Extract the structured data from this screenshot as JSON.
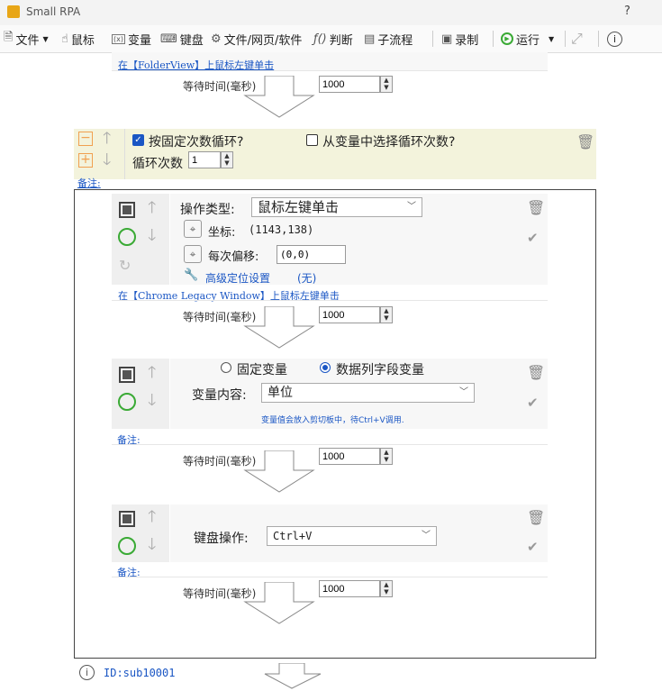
{
  "window": {
    "title": "Small RPA",
    "help": "?"
  },
  "toolbar": {
    "file": "文件",
    "mouse": "鼠标",
    "variable": "变量",
    "keyboard": "键盘",
    "web": "文件/网页/软件",
    "judge": "判断",
    "subflow": "子流程",
    "record": "录制",
    "run": "运行"
  },
  "top_block": {
    "link": "在【FolderView】上鼠标左键单击",
    "wait_label": "等待时间(毫秒)",
    "wait_value": "1000"
  },
  "loop": {
    "fixed_loop_label": "按固定次数循环?",
    "fixed_loop_checked": true,
    "from_var_label": "从变量中选择循环次数?",
    "from_var_checked": false,
    "count_label": "循环次数",
    "count_value": "1",
    "note_link": "备注:"
  },
  "step1": {
    "op_type_label": "操作类型:",
    "op_type_value": "鼠标左键单击",
    "coord_label": "坐标:",
    "coord_value": "(1143,138)",
    "offset_label": "每次偏移:",
    "offset_value": "(0,0)",
    "advanced_label": "高级定位设置",
    "advanced_value": "(无)",
    "link": "在【Chrome Legacy Window】上鼠标左键单击",
    "wait_label": "等待时间(毫秒)",
    "wait_value": "1000"
  },
  "step2": {
    "radio_fixed": "固定变量",
    "radio_column": "数据列字段变量",
    "selected": "数据列字段变量",
    "content_label": "变量内容:",
    "content_value": "单位",
    "hint": "变量值会放入剪切板中，待Ctrl+V调用.",
    "note_link": "备注:",
    "wait_label": "等待时间(毫秒)",
    "wait_value": "1000"
  },
  "step3": {
    "kb_label": "键盘操作:",
    "kb_value": "Ctrl+V",
    "note_link": "备注:",
    "wait_label": "等待时间(毫秒)",
    "wait_value": "1000"
  },
  "footer": {
    "id_label": "ID:sub10001"
  },
  "colors": {
    "accent_green": "#3aaa35",
    "link_blue": "#1a56c4",
    "loop_bg": "#f3f3dc",
    "orange": "#f0a050"
  }
}
